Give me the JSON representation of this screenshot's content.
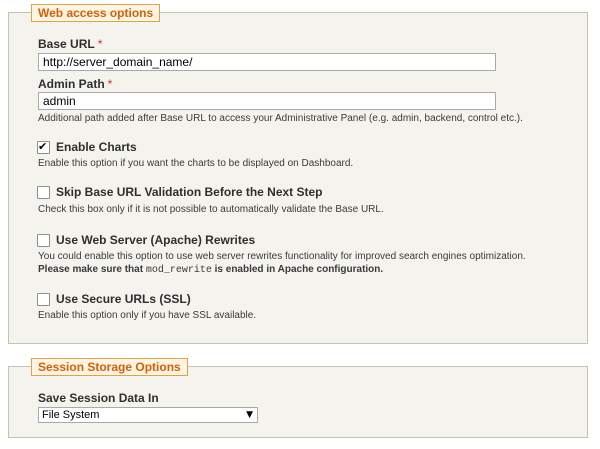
{
  "web_access": {
    "legend": "Web access options",
    "base_url": {
      "label": "Base URL",
      "required_mark": "*",
      "value": "http://server_domain_name/"
    },
    "admin_path": {
      "label": "Admin Path",
      "required_mark": "*",
      "value": "admin",
      "hint": "Additional path added after Base URL to access your Administrative Panel (e.g. admin, backend, control etc.)."
    },
    "enable_charts": {
      "label": "Enable Charts",
      "checked": true,
      "hint": "Enable this option if you want the charts to be displayed on Dashboard."
    },
    "skip_validation": {
      "label": "Skip Base URL Validation Before the Next Step",
      "checked": false,
      "hint": "Check this box only if it is not possible to automatically validate the Base URL."
    },
    "rewrites": {
      "label": "Use Web Server (Apache) Rewrites",
      "checked": false,
      "hint": "You could enable this option to use web server rewrites functionality for improved search engines optimization.",
      "hint2_before": "Please make sure that ",
      "hint2_code": "mod_rewrite",
      "hint2_after": " is enabled in Apache configuration."
    },
    "secure_urls": {
      "label": "Use Secure URLs (SSL)",
      "checked": false,
      "hint": "Enable this option only if you have SSL available."
    }
  },
  "session_storage": {
    "legend": "Session Storage Options",
    "label": "Save Session Data In",
    "selected": "File System"
  },
  "colors": {
    "legend_text": "#d75f07",
    "legend_border": "#e3a142",
    "panel_bg": "#f4f3ee",
    "required": "#e02b27"
  }
}
